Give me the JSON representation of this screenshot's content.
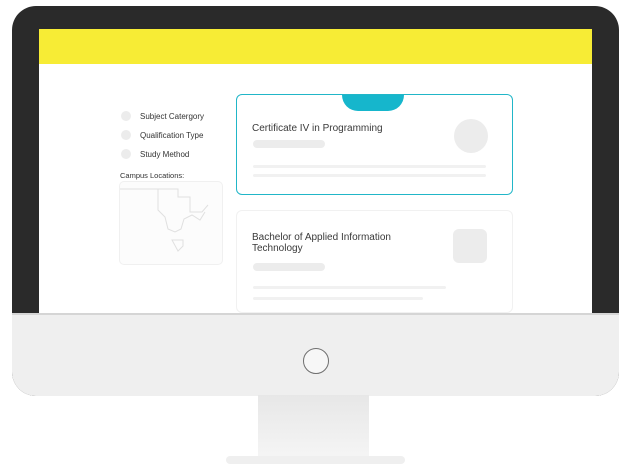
{
  "filters": {
    "items": [
      {
        "label": "Subject Catergory"
      },
      {
        "label": "Qualification Type"
      },
      {
        "label": "Study Method"
      }
    ],
    "campus_locations_label": "Campus Locations:"
  },
  "courses": [
    {
      "title": "Certificate IV in Programming"
    },
    {
      "title": "Bachelor of Applied Information Technology"
    }
  ],
  "colors": {
    "banner": "#f7ec35",
    "accent": "#16b6cc",
    "active_card_border": "#21b6c8",
    "monitor_bezel": "#2a2a2a"
  },
  "icons": {
    "power_button": "power-button-icon",
    "map": "campus-map-icon"
  }
}
